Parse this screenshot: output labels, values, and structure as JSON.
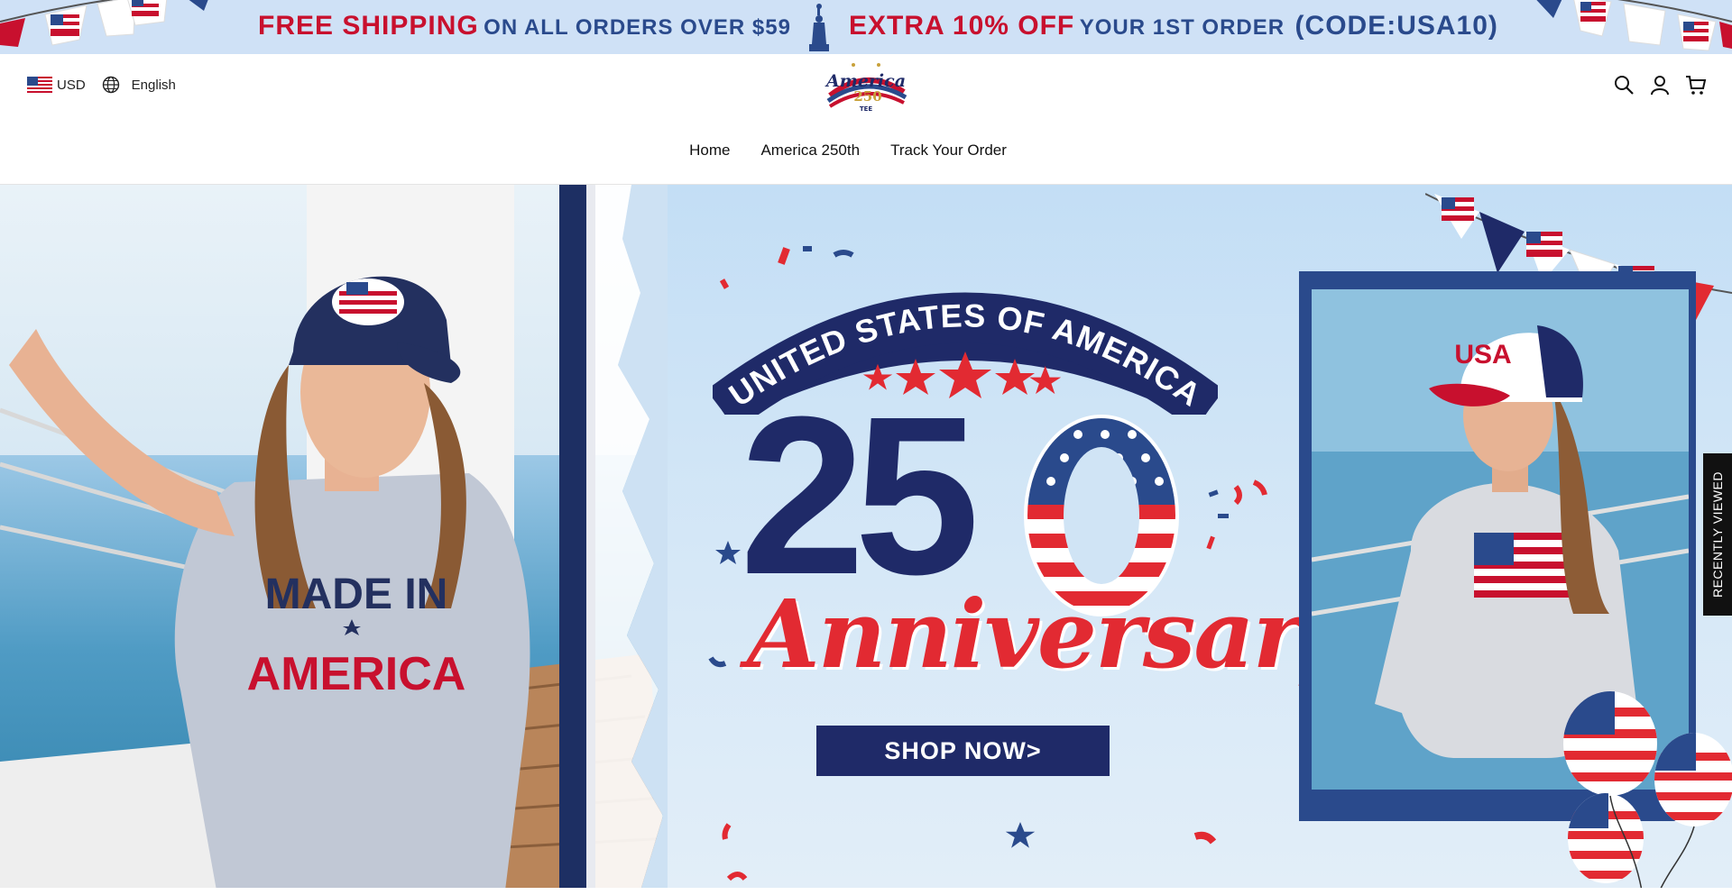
{
  "announcement": {
    "part1_red": "FREE SHIPPING",
    "part1_blue": "ON ALL ORDERS OVER $59",
    "part2_red": "EXTRA 10% OFF",
    "part2_blue": "YOUR 1ST ORDER",
    "code": "(CODE:USA10)"
  },
  "header": {
    "currency": "USD",
    "language": "English",
    "logo_text": "America 250 TEE",
    "icons": [
      "search-icon",
      "account-icon",
      "cart-icon"
    ]
  },
  "nav": {
    "items": [
      {
        "label": "Home"
      },
      {
        "label": "America 250th"
      },
      {
        "label": "Track Your Order"
      }
    ]
  },
  "hero": {
    "arc_text": "UNITED STATES OF AMERICA",
    "number_left": "25",
    "number_right": "0",
    "script_text": "Anniversary",
    "cta": "SHOP NOW>",
    "shirt_left_text_top": "MADE IN",
    "shirt_left_text_bottom": "AMERICA",
    "cap_right_text": "USA"
  },
  "recently_viewed": {
    "label": "RECENTLY VIEWED"
  },
  "colors": {
    "brand_red": "#c8102e",
    "brand_navy": "#1f2a68",
    "brand_blue": "#2a4a8c",
    "announce_bg": "#cfe1f6"
  }
}
